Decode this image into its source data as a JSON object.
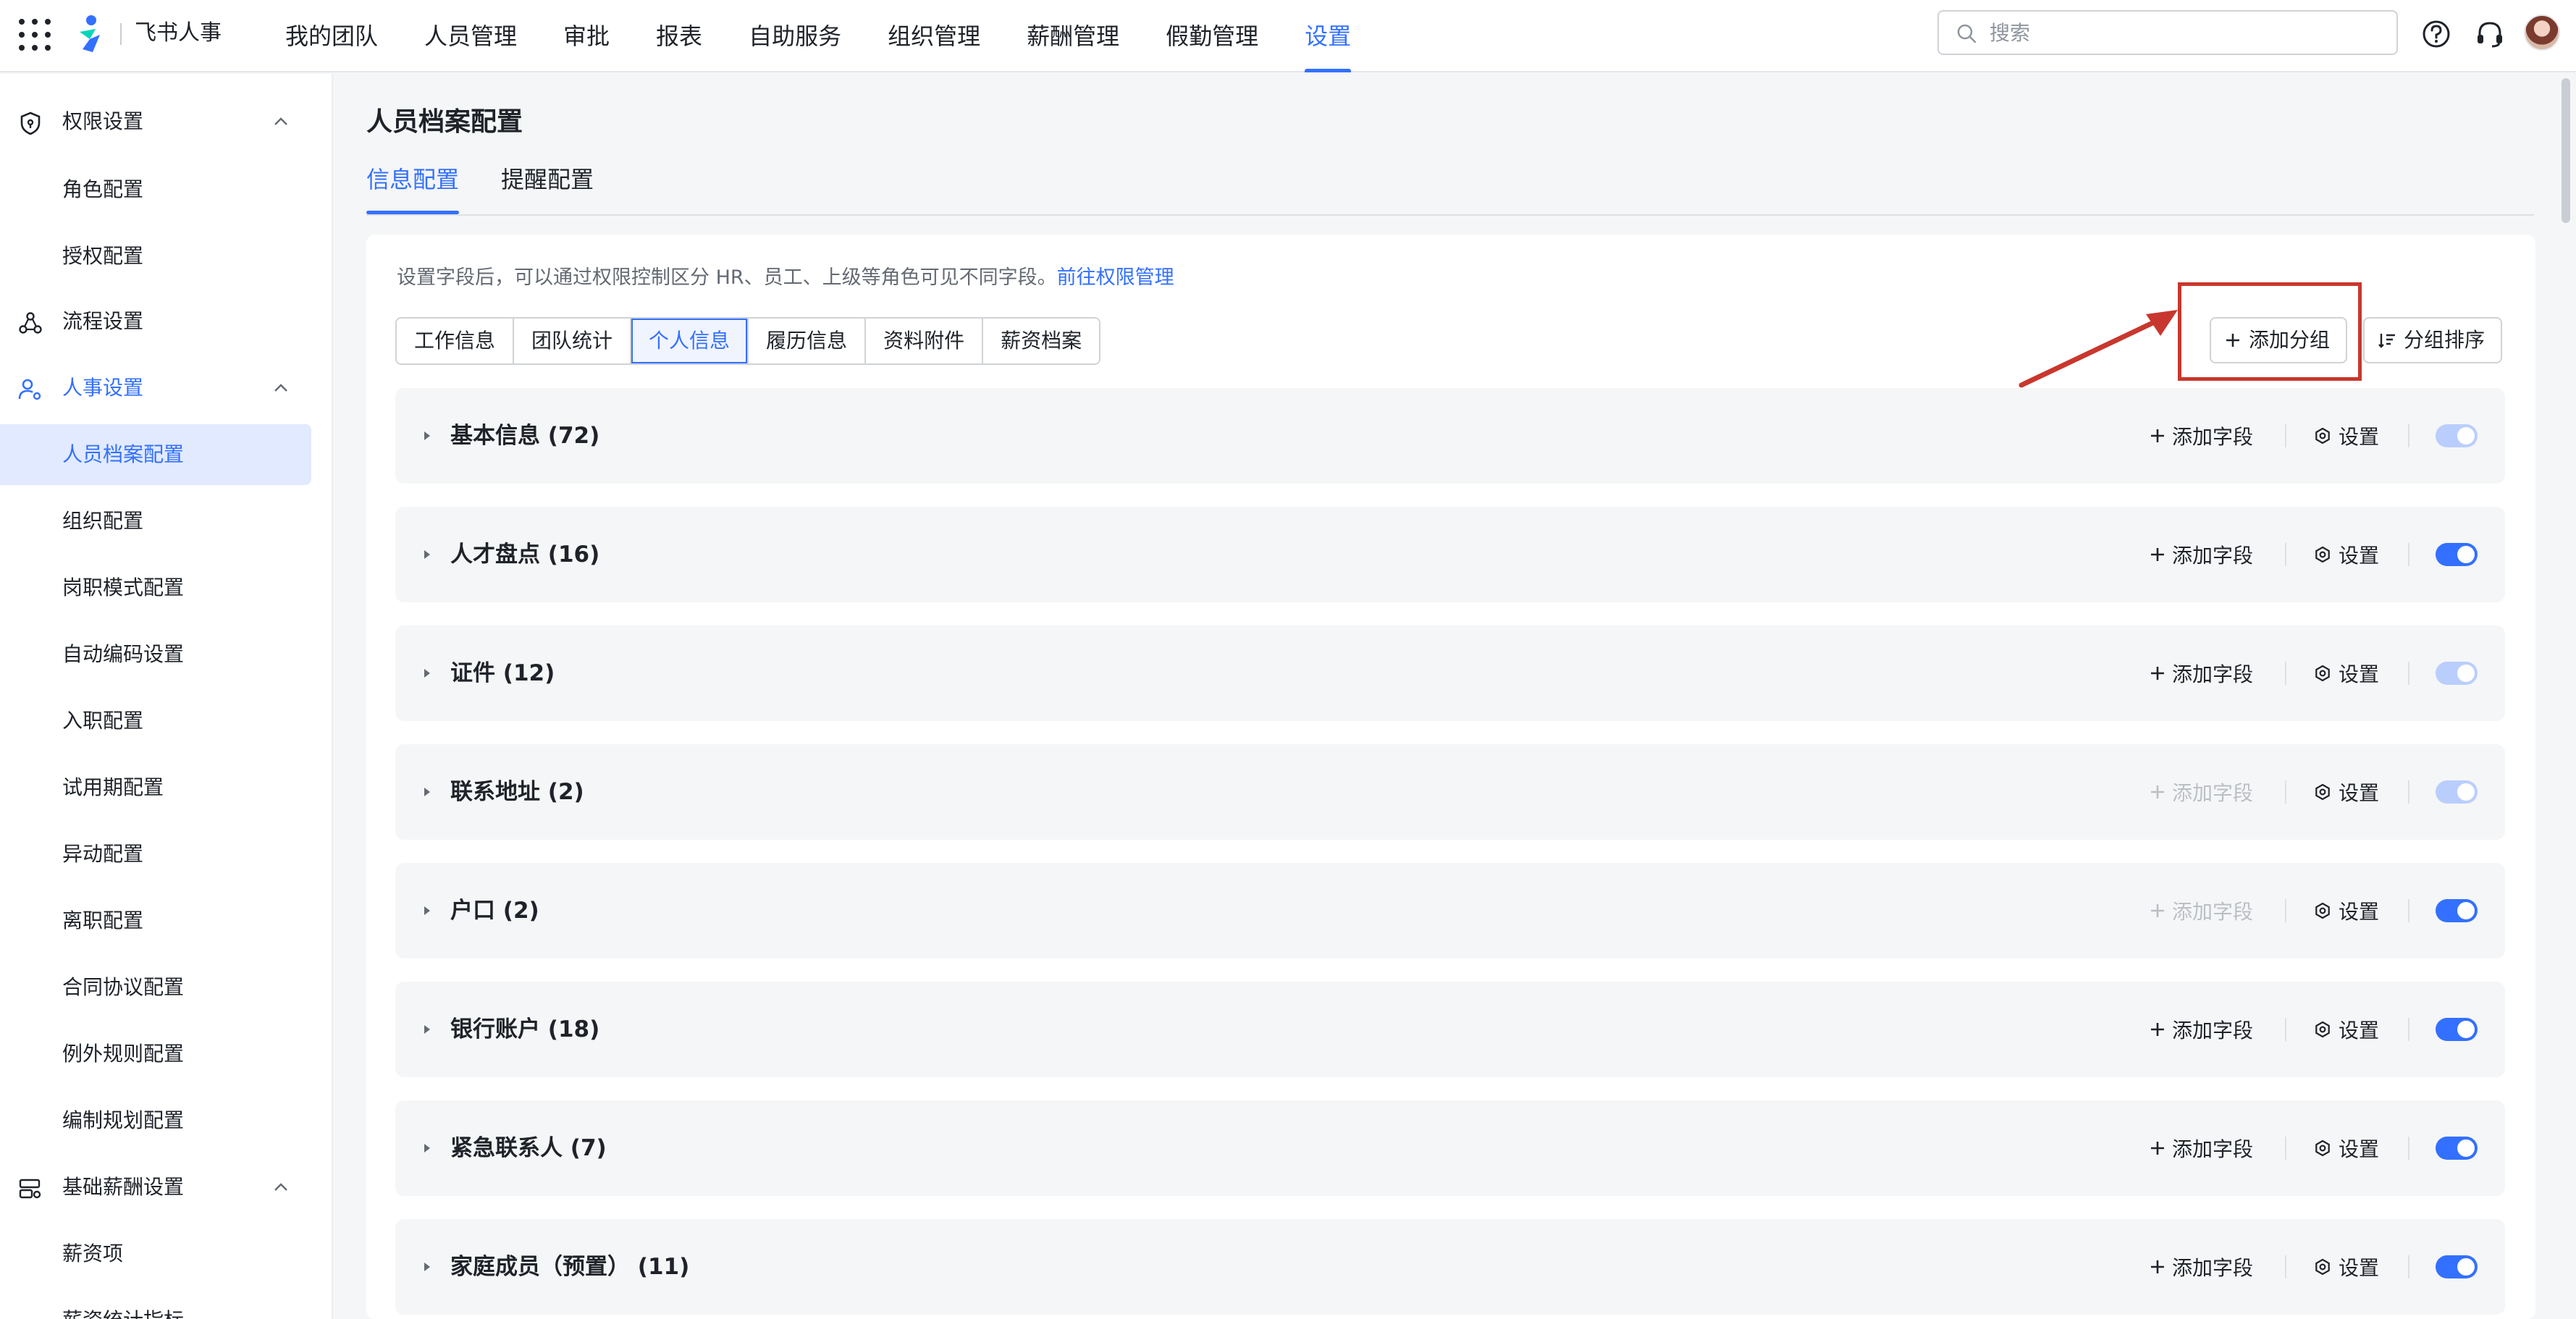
{
  "app": {
    "brand": "飞书人事",
    "nav": [
      "我的团队",
      "人员管理",
      "审批",
      "报表",
      "自助服务",
      "组织管理",
      "薪酬管理",
      "假勤管理",
      "设置"
    ],
    "active_nav": "设置",
    "search_placeholder": "搜索",
    "icons": {
      "apps": "apps-grid-icon",
      "help": "help-icon",
      "support": "headset-icon",
      "avatar": "user-avatar"
    },
    "accent_color": "#3370ff"
  },
  "sidebar": {
    "groups": [
      {
        "label": "权限设置",
        "icon": "shield-icon",
        "expanded": true,
        "items": [
          "角色配置",
          "授权配置"
        ]
      },
      {
        "label": "流程设置",
        "icon": "flow-icon",
        "expanded": false,
        "items": []
      },
      {
        "label": "人事设置",
        "icon": "user-setting-icon",
        "expanded": true,
        "items": [
          "人员档案配置",
          "组织配置",
          "岗职模式配置",
          "自动编码设置",
          "入职配置",
          "试用期配置",
          "异动配置",
          "离职配置",
          "合同协议配置",
          "例外规则配置",
          "编制规划配置"
        ]
      },
      {
        "label": "基础薪酬设置",
        "icon": "salary-icon",
        "expanded": true,
        "items": [
          "薪资项",
          "薪资统计指标"
        ]
      }
    ],
    "active_item": "人员档案配置"
  },
  "main": {
    "title": "人员档案配置",
    "tabs": [
      "信息配置",
      "提醒配置"
    ],
    "active_tab": "信息配置",
    "hint": "设置字段后，可以通过权限控制区分 HR、员工、上级等角色可见不同字段。",
    "hint_link": "前往权限管理",
    "segments": [
      "工作信息",
      "团队统计",
      "个人信息",
      "履历信息",
      "资料附件",
      "薪资档案"
    ],
    "active_segment": "个人信息",
    "add_group_label": "添加分组",
    "sort_group_label": "分组排序",
    "add_field_label": "添加字段",
    "settings_label": "设置",
    "groups": [
      {
        "name": "基本信息 (72)",
        "add_enabled": true,
        "toggle": "locked"
      },
      {
        "name": "人才盘点 (16)",
        "add_enabled": true,
        "toggle": "on"
      },
      {
        "name": "证件 (12)",
        "add_enabled": true,
        "toggle": "locked"
      },
      {
        "name": "联系地址 (2)",
        "add_enabled": false,
        "toggle": "locked"
      },
      {
        "name": "户口 (2)",
        "add_enabled": false,
        "toggle": "on"
      },
      {
        "name": "银行账户 (18)",
        "add_enabled": true,
        "toggle": "on"
      },
      {
        "name": "紧急联系人 (7)",
        "add_enabled": true,
        "toggle": "on"
      },
      {
        "name": "家庭成员（预置） (11)",
        "add_enabled": true,
        "toggle": "on"
      }
    ]
  }
}
